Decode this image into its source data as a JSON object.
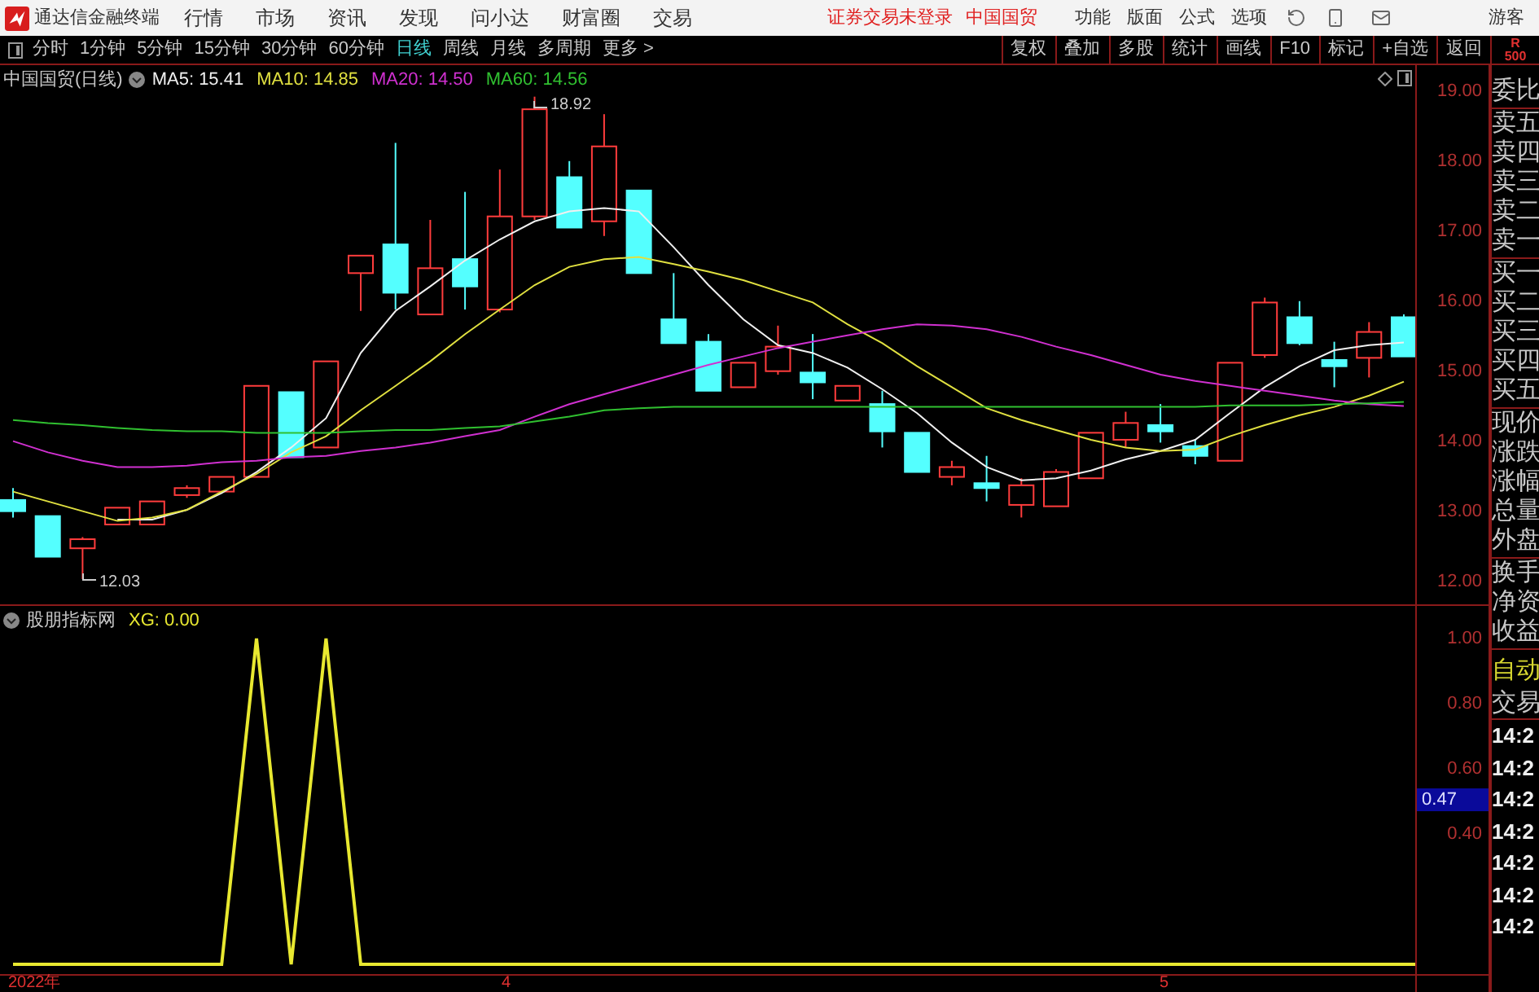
{
  "menu_bar": {
    "app_title": "通达信金融终端",
    "menus": [
      "行情",
      "市场",
      "资讯",
      "发现",
      "问小达",
      "财富圈",
      "交易"
    ],
    "status": [
      "证券交易未登录",
      "中国国贸"
    ],
    "tools": [
      "功能",
      "版面",
      "公式",
      "选项"
    ],
    "user": "游客"
  },
  "toolbar": {
    "periods": [
      {
        "label": "分时",
        "selected": false
      },
      {
        "label": "1分钟",
        "selected": false
      },
      {
        "label": "5分钟",
        "selected": false
      },
      {
        "label": "15分钟",
        "selected": false
      },
      {
        "label": "30分钟",
        "selected": false
      },
      {
        "label": "60分钟",
        "selected": false
      },
      {
        "label": "日线",
        "selected": true
      },
      {
        "label": "周线",
        "selected": false
      },
      {
        "label": "月线",
        "selected": false
      },
      {
        "label": "多周期",
        "selected": false
      }
    ],
    "more": "更多 >",
    "buttons": [
      "复权",
      "叠加",
      "多股",
      "统计",
      "画线",
      "F10",
      "标记",
      "+自选",
      "返回"
    ],
    "badge": [
      "R",
      "500"
    ]
  },
  "price_pane": {
    "title": "中国国贸(日线)",
    "legend_readings": [
      ": 15.41",
      ": 14.85",
      ": 14.50",
      ": 14.56"
    ],
    "high_label": "18.92",
    "low_label": "12.03",
    "chart_data": {
      "type": "candlestick",
      "ylim": [
        11.67,
        19.37
      ],
      "ohlc": [
        [
          13.16,
          13.33,
          12.91,
          13.0
        ],
        [
          12.93,
          12.93,
          12.35,
          12.35
        ],
        [
          12.47,
          12.63,
          12.03,
          12.6
        ],
        [
          12.81,
          13.05,
          12.81,
          13.05
        ],
        [
          12.81,
          13.14,
          12.81,
          13.14
        ],
        [
          13.23,
          13.37,
          13.19,
          13.33
        ],
        [
          13.28,
          13.49,
          13.28,
          13.49
        ],
        [
          13.49,
          14.79,
          13.49,
          14.79
        ],
        [
          14.7,
          14.7,
          13.77,
          13.77
        ],
        [
          13.91,
          15.14,
          13.91,
          15.14
        ],
        [
          16.4,
          16.65,
          15.86,
          16.65
        ],
        [
          16.81,
          18.26,
          15.88,
          16.12
        ],
        [
          15.81,
          17.16,
          15.81,
          16.47
        ],
        [
          16.6,
          17.56,
          15.88,
          16.21
        ],
        [
          15.88,
          17.88,
          15.84,
          17.21
        ],
        [
          17.21,
          18.92,
          17.16,
          18.74
        ],
        [
          17.77,
          18.0,
          17.05,
          17.05
        ],
        [
          17.14,
          18.67,
          16.93,
          18.21
        ],
        [
          17.58,
          17.58,
          16.4,
          16.4
        ],
        [
          15.74,
          16.4,
          15.4,
          15.4
        ],
        [
          15.42,
          15.53,
          14.72,
          14.72
        ],
        [
          14.77,
          15.12,
          14.77,
          15.12
        ],
        [
          15.0,
          15.65,
          14.95,
          15.35
        ],
        [
          14.98,
          15.53,
          14.6,
          14.84
        ],
        [
          14.58,
          14.79,
          14.58,
          14.79
        ],
        [
          14.53,
          14.72,
          13.91,
          14.14
        ],
        [
          14.12,
          14.12,
          13.56,
          13.56
        ],
        [
          13.49,
          13.72,
          13.37,
          13.63
        ],
        [
          13.4,
          13.79,
          13.14,
          13.33
        ],
        [
          13.09,
          13.47,
          12.91,
          13.37
        ],
        [
          13.07,
          13.6,
          13.07,
          13.56
        ],
        [
          13.47,
          14.12,
          13.47,
          14.12
        ],
        [
          14.02,
          14.42,
          13.91,
          14.26
        ],
        [
          14.23,
          14.53,
          13.98,
          14.14
        ],
        [
          13.93,
          14.02,
          13.67,
          13.79
        ],
        [
          13.72,
          15.12,
          13.72,
          15.12
        ],
        [
          15.23,
          16.05,
          15.19,
          15.98
        ],
        [
          15.77,
          16.0,
          15.37,
          15.4
        ],
        [
          15.16,
          15.42,
          14.77,
          15.07
        ],
        [
          15.19,
          15.7,
          14.91,
          15.56
        ],
        [
          15.77,
          15.81,
          15.21,
          15.21
        ]
      ],
      "yticks": [
        {
          "value": 19,
          "label": "19.00"
        },
        {
          "value": 18,
          "label": "18.00"
        },
        {
          "value": 17,
          "label": "17.00"
        },
        {
          "value": 16,
          "label": "16.00"
        },
        {
          "value": 15,
          "label": "15.00"
        },
        {
          "value": 14,
          "label": "14.00"
        },
        {
          "value": 13,
          "label": "13.00"
        },
        {
          "value": 12,
          "label": "12.00"
        }
      ],
      "series": [
        {
          "name": "MA5",
          "type": "line",
          "color": "#f0f0f0",
          "values": [
            null,
            null,
            null,
            12.88,
            12.88,
            13.02,
            13.26,
            13.56,
            13.91,
            14.33,
            15.26,
            15.86,
            16.21,
            16.58,
            16.88,
            17.14,
            17.28,
            17.33,
            17.28,
            16.77,
            16.23,
            15.74,
            15.37,
            15.26,
            15.05,
            14.74,
            14.4,
            13.98,
            13.63,
            13.44,
            13.47,
            13.58,
            13.74,
            13.86,
            14.02,
            14.4,
            14.77,
            15.07,
            15.3,
            15.37,
            15.41
          ]
        },
        {
          "name": "MA10",
          "type": "line",
          "color": "#e0e040",
          "values": [
            13.28,
            13.14,
            13.0,
            12.86,
            12.91,
            13.02,
            13.28,
            13.53,
            13.84,
            14.07,
            14.44,
            14.79,
            15.14,
            15.53,
            15.88,
            16.23,
            16.49,
            16.6,
            16.63,
            16.53,
            16.42,
            16.3,
            16.14,
            15.98,
            15.67,
            15.4,
            15.07,
            14.77,
            14.47,
            14.3,
            14.16,
            14.02,
            13.91,
            13.86,
            13.88,
            14.07,
            14.23,
            14.37,
            14.49,
            14.65,
            14.85
          ]
        },
        {
          "name": "MA20",
          "type": "line",
          "color": "#d030d0",
          "values": [
            14.0,
            13.84,
            13.72,
            13.63,
            13.63,
            13.65,
            13.7,
            13.72,
            13.77,
            13.79,
            13.86,
            13.91,
            13.98,
            14.07,
            14.16,
            14.35,
            14.53,
            14.67,
            14.81,
            14.95,
            15.09,
            15.21,
            15.33,
            15.42,
            15.51,
            15.6,
            15.67,
            15.65,
            15.6,
            15.49,
            15.35,
            15.23,
            15.09,
            14.95,
            14.86,
            14.79,
            14.72,
            14.65,
            14.58,
            14.53,
            14.5
          ]
        },
        {
          "name": "MA60",
          "type": "line",
          "color": "#30c030",
          "values": [
            14.3,
            14.26,
            14.23,
            14.19,
            14.16,
            14.14,
            14.14,
            14.12,
            14.12,
            14.12,
            14.14,
            14.16,
            14.16,
            14.19,
            14.21,
            14.28,
            14.35,
            14.44,
            14.47,
            14.49,
            14.49,
            14.49,
            14.49,
            14.49,
            14.49,
            14.49,
            14.49,
            14.49,
            14.49,
            14.49,
            14.49,
            14.49,
            14.49,
            14.49,
            14.49,
            14.51,
            14.51,
            14.51,
            14.53,
            14.54,
            14.56
          ]
        }
      ]
    }
  },
  "indicator_pane": {
    "title": "股朋指标网",
    "legend_readings": [
      ": 0.00"
    ],
    "cursor_value": "0.47",
    "chart_data": {
      "type": "line",
      "ylim": [
        -0.03,
        1.1
      ],
      "yticks": [
        {
          "value": 1,
          "label": "1.00"
        },
        {
          "value": 0.8,
          "label": "0.80"
        },
        {
          "value": 0.6,
          "label": "0.60"
        },
        {
          "value": 0.4,
          "label": "0.40"
        }
      ],
      "series": [
        {
          "name": "XG",
          "color": "#e8e830",
          "values": [
            0,
            0,
            0,
            0,
            0,
            0,
            0,
            1,
            0,
            1,
            0,
            0,
            0,
            0,
            0,
            0,
            0,
            0,
            0,
            0,
            0,
            0,
            0,
            0,
            0,
            0,
            0,
            0,
            0,
            0,
            0,
            0,
            0,
            0,
            0,
            0,
            0,
            0,
            0,
            0,
            0
          ]
        }
      ]
    }
  },
  "time_axis": [
    "2022年",
    "4",
    "5"
  ],
  "quote_panel": {
    "groups": [
      [
        "委比"
      ],
      [
        "卖五",
        "卖四",
        "卖三",
        "卖二",
        "卖一"
      ],
      [
        "买一",
        "买二",
        "买三",
        "买四",
        "买五"
      ],
      [
        "现价",
        "涨跌",
        "涨幅",
        "总量",
        "外盘"
      ],
      [
        "换手",
        "净资",
        "收益"
      ]
    ],
    "auto": "自动",
    "trade": "交易",
    "times": [
      "14:2",
      "14:2",
      "14:2",
      "14:2",
      "14:2",
      "14:2",
      "14:2"
    ]
  }
}
